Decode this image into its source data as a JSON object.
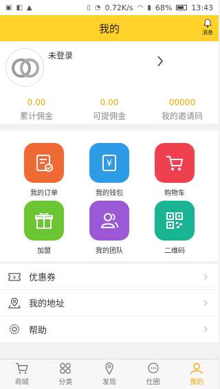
{
  "status_bar": {
    "speed": "0.72K/s",
    "battery": "68%",
    "time": "13:43"
  },
  "header": {
    "title": "我的",
    "message_label": "消息"
  },
  "profile": {
    "login_status": "未登录"
  },
  "stats": [
    {
      "value": "0.00",
      "label": "累计佣金"
    },
    {
      "value": "0.00",
      "label": "可提佣金"
    },
    {
      "value": "00000",
      "label": "我的邀请码"
    }
  ],
  "grid": [
    {
      "label": "我的订单",
      "color": "#f06a35",
      "icon": "order-icon"
    },
    {
      "label": "我的钱包",
      "color": "#2d9be6",
      "icon": "wallet-icon"
    },
    {
      "label": "购物车",
      "color": "#ef4150",
      "icon": "cart-icon"
    },
    {
      "label": "加盟",
      "color": "#6cc634",
      "icon": "gift-icon"
    },
    {
      "label": "我的团队",
      "color": "#9b59d6",
      "icon": "team-icon"
    },
    {
      "label": "二维码",
      "color": "#18b494",
      "icon": "qr-code-icon"
    }
  ],
  "list": [
    {
      "label": "优惠券",
      "icon": "coupon-icon"
    },
    {
      "label": "我的地址",
      "icon": "location-icon"
    },
    {
      "label": "帮助",
      "icon": "help-icon"
    }
  ],
  "tabs": [
    {
      "label": "商城",
      "icon": "cart-tab-icon"
    },
    {
      "label": "分类",
      "icon": "category-icon"
    },
    {
      "label": "发现",
      "icon": "discover-icon"
    },
    {
      "label": "仕圈",
      "icon": "chat-icon"
    },
    {
      "label": "我的",
      "icon": "profile-icon"
    }
  ],
  "colors": {
    "accent": "#ffd12b",
    "value": "#f0a800"
  }
}
